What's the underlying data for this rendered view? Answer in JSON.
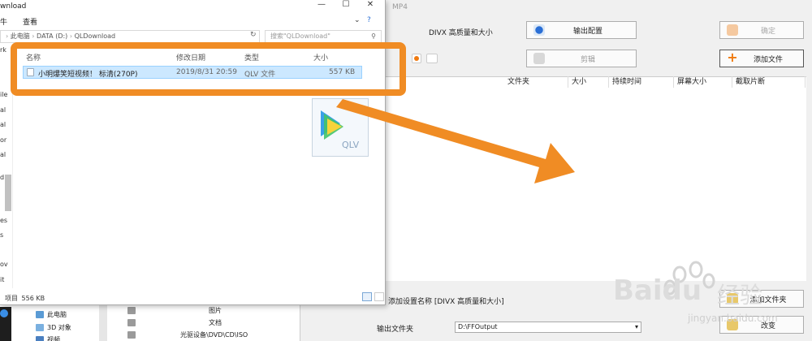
{
  "format_factory": {
    "title": "MP4",
    "profile_label": "DIVX 高质量和大小",
    "output_config_button": "输出配置",
    "ok_button": "确定",
    "clip_button": "剪辑",
    "add_file_button": "添加文件",
    "columns": [
      "文件夹",
      "大小",
      "持续时间",
      "屏幕大小",
      "截取片断"
    ],
    "add_setting_label": "添加设置名称 [DIVX 高质量和大小]",
    "add_folder_button": "添加文件夹",
    "output_folder_label": "输出文件夹",
    "output_folder_value": "D:\\FFOutput",
    "change_button": "改变"
  },
  "explorer": {
    "title": "wnload",
    "menu_file": "牛",
    "menu_view": "查看",
    "address_parts": [
      "此电脑",
      "DATA (D:)",
      "QLDownload"
    ],
    "search_placeholder": "搜索\"QLDownload\"",
    "columns": {
      "name": "名称",
      "modified": "修改日期",
      "type": "类型",
      "size": "大小"
    },
    "file": {
      "name": "小明爆笑短视频！ 标清(270P)",
      "modified": "2019/8/31 20:59",
      "type": "QLV 文件",
      "size": "557 KB"
    },
    "qlv_label": "QLV",
    "status_left": "项目",
    "status_size": "556 KB",
    "nav_fragments": [
      "rk",
      "ile",
      "al",
      "al",
      "or",
      "al",
      "d",
      "es",
      "s",
      "ov",
      "it"
    ]
  },
  "explorer_lower": {
    "pc": "此电脑",
    "objects3d": "3D 对象",
    "video": "视频",
    "pictures": "图片",
    "documents": "文档",
    "dvd": "光驱设备\\DVD\\CD\\ISO"
  },
  "watermark": {
    "brand": "Bai",
    "brand2": "du",
    "jingyan": "经验",
    "url": "jingyan.baidu.com"
  },
  "colors": {
    "highlight": "#f08c24",
    "selection": "#cce8ff",
    "selection_border": "#99d1ff"
  }
}
